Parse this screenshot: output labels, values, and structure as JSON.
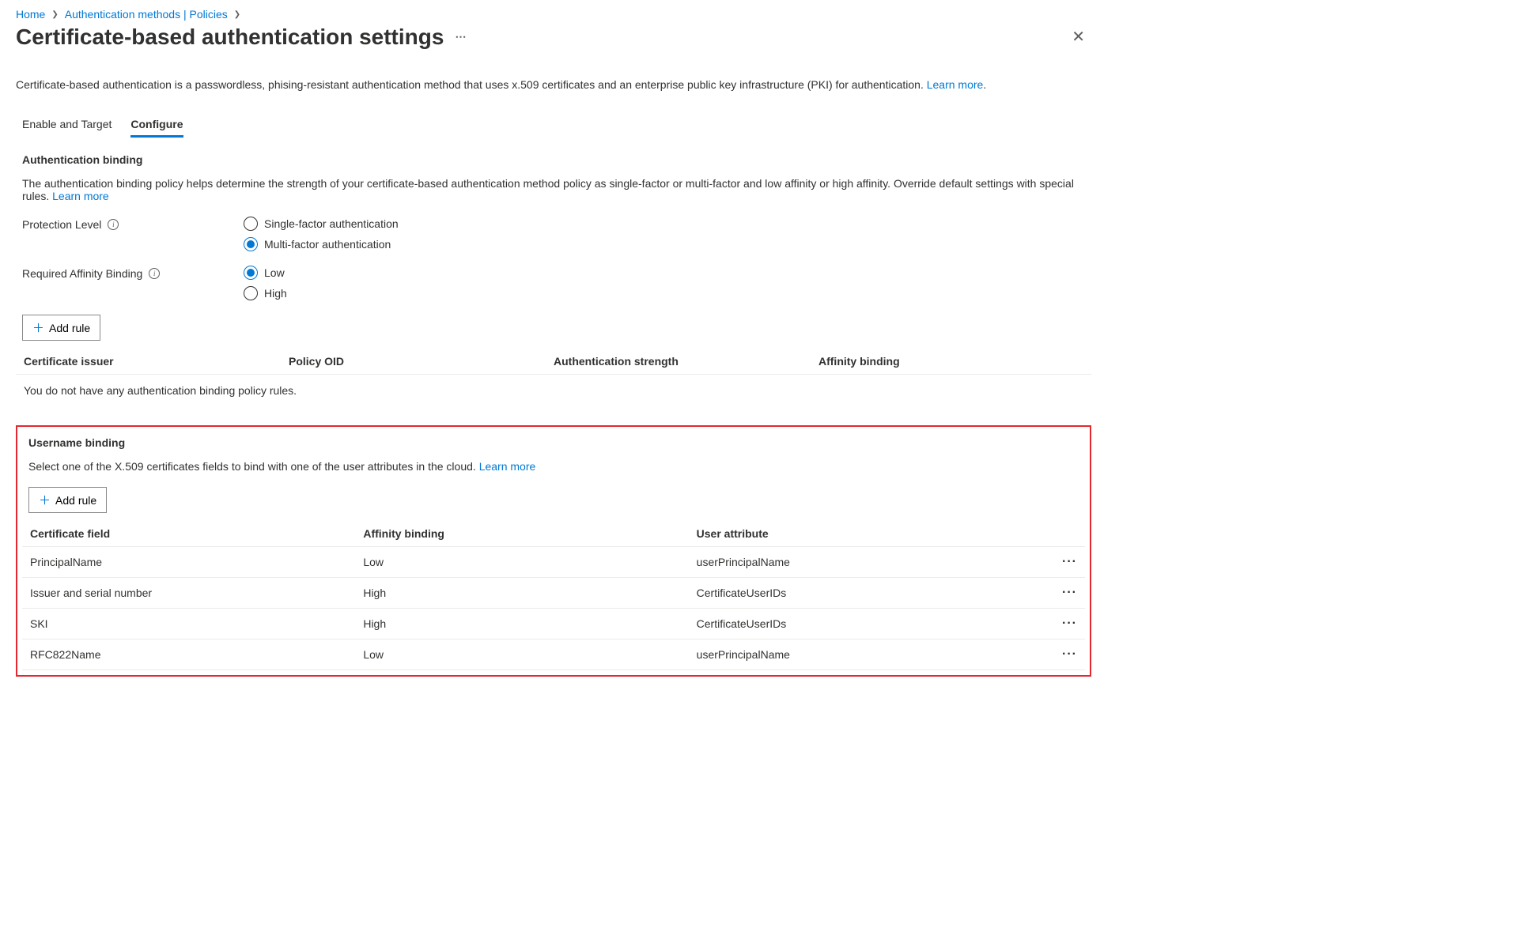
{
  "breadcrumb": {
    "home": "Home",
    "authMethods": "Authentication methods | Policies"
  },
  "pageTitle": "Certificate-based authentication settings",
  "description": "Certificate-based authentication is a passwordless, phising-resistant authentication method that uses x.509 certificates and an enterprise public key infrastructure (PKI) for authentication.",
  "learnMore": "Learn more",
  "tabs": {
    "enable": "Enable and Target",
    "configure": "Configure"
  },
  "authBinding": {
    "title": "Authentication binding",
    "desc": "The authentication binding policy helps determine the strength of your certificate-based authentication method policy as single-factor or multi-factor and low affinity or high affinity. Override default settings with special rules.",
    "protectionLabel": "Protection Level",
    "singleFactor": "Single-factor authentication",
    "multiFactor": "Multi-factor authentication",
    "requiredAffinityLabel": "Required Affinity Binding",
    "low": "Low",
    "high": "High",
    "addRule": "Add rule",
    "headers": {
      "issuer": "Certificate issuer",
      "policyOid": "Policy OID",
      "authStrength": "Authentication strength",
      "affinity": "Affinity binding"
    },
    "emptyMsg": "You do not have any authentication binding policy rules."
  },
  "usernameBinding": {
    "title": "Username binding",
    "desc": "Select one of the X.509 certificates fields to bind with one of the user attributes in the cloud.",
    "addRule": "Add rule",
    "headers": {
      "certField": "Certificate field",
      "affinity": "Affinity binding",
      "userAttr": "User attribute"
    },
    "rows": [
      {
        "certField": "PrincipalName",
        "affinity": "Low",
        "userAttr": "userPrincipalName"
      },
      {
        "certField": "Issuer and serial number",
        "affinity": "High",
        "userAttr": "CertificateUserIDs"
      },
      {
        "certField": "SKI",
        "affinity": "High",
        "userAttr": "CertificateUserIDs"
      },
      {
        "certField": "RFC822Name",
        "affinity": "Low",
        "userAttr": "userPrincipalName"
      }
    ]
  }
}
